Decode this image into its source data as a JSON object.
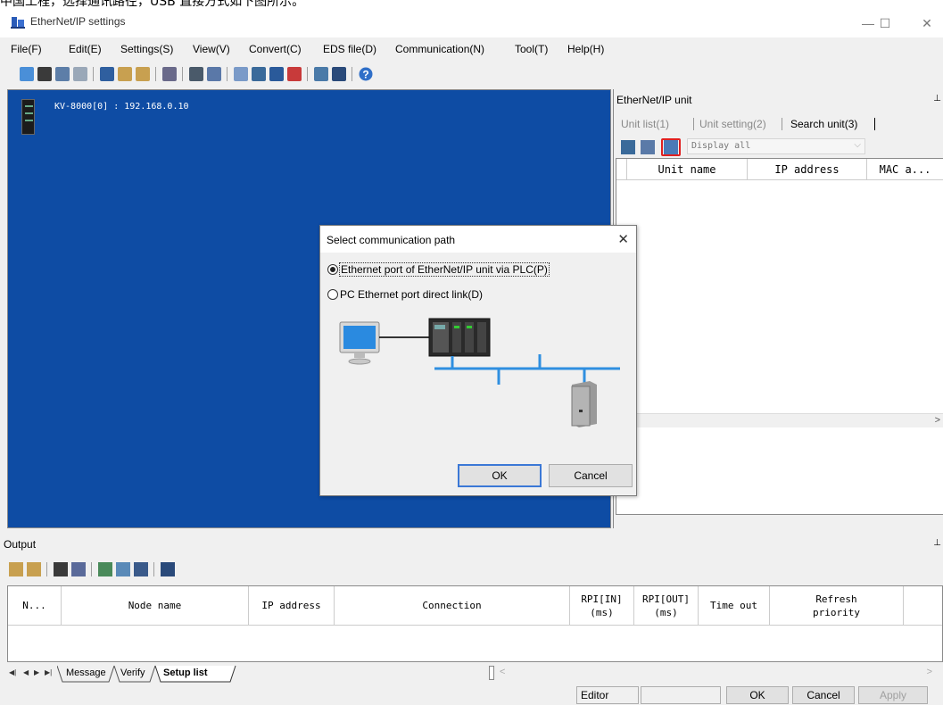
{
  "top_strip_text": "中国工程，选择通讯路径，USB 直接方式如下图所示。",
  "window": {
    "title": "EtherNet/IP settings",
    "minimize": "—",
    "maximize": "☐",
    "close": "✕"
  },
  "menu": [
    "File(F)",
    "Edit(E)",
    "Settings(S)",
    "View(V)",
    "Convert(C)",
    "EDS file(D)",
    "Communication(N)",
    "Tool(T)",
    "Help(H)"
  ],
  "canvas": {
    "device_label": "KV-8000[0] : 192.168.0.10"
  },
  "right_panel": {
    "title": "EtherNet/IP unit",
    "tabs": [
      {
        "label": "Unit list(1)",
        "active": false
      },
      {
        "label": "Unit setting(2)",
        "active": false
      },
      {
        "label": "Search unit(3)",
        "active": true
      }
    ],
    "filter_value": "Display all",
    "columns": [
      "Unit name",
      "IP address",
      "MAC a..."
    ]
  },
  "dialog": {
    "title": "Select communication path",
    "options": [
      {
        "label": "Ethernet port of EtherNet/IP unit via PLC(P)",
        "selected": true
      },
      {
        "label": "PC Ethernet port direct link(D)",
        "selected": false
      }
    ],
    "ok_label": "OK",
    "cancel_label": "Cancel"
  },
  "output": {
    "title": "Output",
    "columns": [
      "N...",
      "Node name",
      "IP address",
      "Connection",
      "RPI[IN]\n(ms)",
      "RPI[OUT]\n(ms)",
      "Time out",
      "Refresh\npriority"
    ],
    "tabs": [
      {
        "label": "Message",
        "active": false
      },
      {
        "label": "Verify",
        "active": false
      },
      {
        "label": "Setup list",
        "active": true
      }
    ]
  },
  "statusbar": {
    "mode": "Editor",
    "ok_label": "OK",
    "cancel_label": "Cancel",
    "apply_label": "Apply"
  },
  "colors": {
    "canvas_bg": "#0e4ca4",
    "highlight_box": "#e02020",
    "network_line": "#2f8fe0",
    "default_button_border": "#3b78d6"
  }
}
